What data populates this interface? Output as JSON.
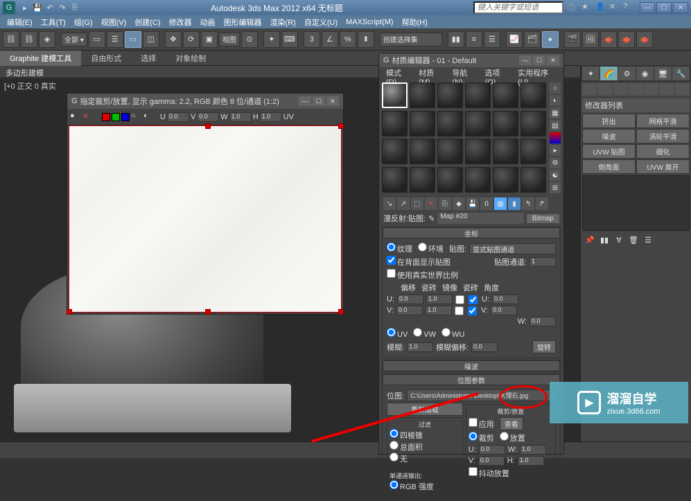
{
  "titlebar": {
    "app_title": "Autodesk 3ds Max  2012 x64   无标题",
    "search_placeholder": "键入关键字或短语"
  },
  "menubar": {
    "items": [
      "编辑(E)",
      "工具(T)",
      "组(G)",
      "视图(V)",
      "创建(C)",
      "修改器",
      "动画",
      "图形编辑器",
      "渲染(R)",
      "自定义(U)",
      "MAXScript(M)",
      "帮助(H)"
    ]
  },
  "toolbar": {
    "view_combo": "视图",
    "selset_combo": "创建选择集"
  },
  "ribbon": {
    "tabs": [
      "Graphite 建模工具",
      "自由形式",
      "选择",
      "对象绘制"
    ],
    "poly_label": "多边形建模"
  },
  "viewport": {
    "label": "[+0 正交 0 真实"
  },
  "crop_window": {
    "title": "指定裁剪/放置, 显示 gamma: 2.2, RGB 颜色 8 位/通道 (1:2)",
    "u": "0.0",
    "v": "0.0",
    "w": "1.0",
    "h": "1.0",
    "uv": "UV"
  },
  "mat_editor": {
    "title": "材质编辑器 - 01 - Default",
    "menu": [
      "模式(D)",
      "材质(M)",
      "导航(N)",
      "选项(O)",
      "实用程序(U)"
    ],
    "slot_label": "漫反射:贴图:",
    "map_name": "Map #20",
    "map_type": "Bitmap",
    "rollout_coord": "坐标",
    "coord": {
      "texture": "纹理",
      "environ": "环境",
      "maplabel": "贴图:",
      "mapchannel": "显式贴图通道",
      "showback": "在背面显示贴图",
      "mapch_label": "贴图通道:",
      "mapch_val": "1",
      "realworld": "使用真实世界比例",
      "headers": [
        "偏移",
        "瓷砖",
        "镜像",
        "瓷砖",
        "角度"
      ],
      "u_label": "U:",
      "v_label": "V:",
      "w_label": "W:",
      "u_off": "0.0",
      "u_tile": "1.0",
      "u_ang": "0.0",
      "v_off": "0.0",
      "v_tile": "1.0",
      "v_ang": "0.0",
      "w_ang": "0.0",
      "uv": "UV",
      "vw": "VW",
      "wu": "WU",
      "blur_label": "模糊:",
      "blur": "1.0",
      "bluroff_label": "模糊偏移:",
      "bluroff": "0.0",
      "rotate": "旋转"
    },
    "rollout_noise": "噪波",
    "rollout_bitmap": "位图参数",
    "bitmap": {
      "label": "位图:",
      "path": "C:\\Users\\Administrator\\Desktop\\大理石.jpg",
      "reload": "重新加载",
      "cropgroup": "裁剪/放置",
      "apply": "应用",
      "view": "查看",
      "crop": "裁剪",
      "place": "放置",
      "u": "U:",
      "uv": "0.0",
      "w": "W:",
      "wv": "1.0",
      "v": "V:",
      "vv": "0.0",
      "h": "H:",
      "hv": "1.0",
      "jitter": "抖动放置",
      "filtergroup": "过滤",
      "pyramid": "四棱锥",
      "summed": "总面积",
      "none": "无",
      "monogroup": "单通道输出:",
      "rgbint": "RGB 强度"
    }
  },
  "right_panel": {
    "modlist": "修改器列表",
    "buttons": [
      "挤出",
      "网格平滑",
      "噪波",
      "涡轮平滑",
      "UVW 贴图",
      "细化",
      "倒角面",
      "UVW 展开"
    ]
  },
  "watermark": {
    "big": "溜溜自学",
    "small": "zixue.3d66.com"
  }
}
